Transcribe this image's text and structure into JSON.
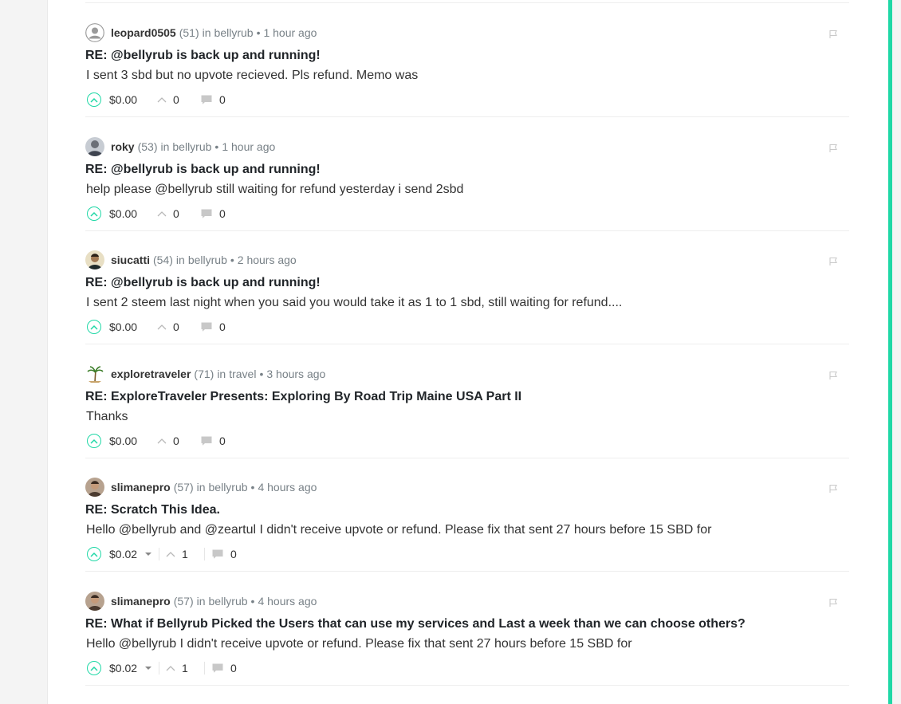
{
  "colors": {
    "accent": "#1fd8a6",
    "muted": "#788187"
  },
  "comments": [
    {
      "author": "leopard0505",
      "reputation": "(51)",
      "in_label": "in",
      "community": "bellyrub",
      "separator": "•",
      "time": "1 hour ago",
      "avatar": "default-user-avatar",
      "title": "RE: @bellyrub is back up and running!",
      "body": "I sent 3 sbd but no upvote recieved. Pls refund. Memo was",
      "payout": "$0.00",
      "votes": "0",
      "replies": "0",
      "has_dropdown": false
    },
    {
      "author": "roky",
      "reputation": "(53)",
      "in_label": "in",
      "community": "bellyrub",
      "separator": "•",
      "time": "1 hour ago",
      "avatar": "user-photo-avatar",
      "title": "RE: @bellyrub is back up and running!",
      "body": "help please @bellyrub still waiting for refund yesterday i send 2sbd",
      "payout": "$0.00",
      "votes": "0",
      "replies": "0",
      "has_dropdown": false
    },
    {
      "author": "siucatti",
      "reputation": "(54)",
      "in_label": "in",
      "community": "bellyrub",
      "separator": "•",
      "time": "2 hours ago",
      "avatar": "user-photo-avatar",
      "title": "RE: @bellyrub is back up and running!",
      "body": "I sent 2 steem last night when you said you would take it as 1 to 1 sbd, still waiting for refund....",
      "payout": "$0.00",
      "votes": "0",
      "replies": "0",
      "has_dropdown": false
    },
    {
      "author": "exploretraveler",
      "reputation": "(71)",
      "in_label": "in",
      "community": "travel",
      "separator": "•",
      "time": "3 hours ago",
      "avatar": "palm-tree-avatar",
      "title": "RE: ExploreTraveler Presents: Exploring By Road Trip Maine USA Part II",
      "body": "Thanks",
      "payout": "$0.00",
      "votes": "0",
      "replies": "0",
      "has_dropdown": false
    },
    {
      "author": "slimanepro",
      "reputation": "(57)",
      "in_label": "in",
      "community": "bellyrub",
      "separator": "•",
      "time": "4 hours ago",
      "avatar": "user-photo-avatar",
      "title": "RE: Scratch This Idea.",
      "body": "Hello @bellyrub and @zeartul I didn't receive upvote or refund. Please fix that sent 27 hours before 15 SBD for",
      "payout": "$0.02",
      "votes": "1",
      "replies": "0",
      "has_dropdown": true
    },
    {
      "author": "slimanepro",
      "reputation": "(57)",
      "in_label": "in",
      "community": "bellyrub",
      "separator": "•",
      "time": "4 hours ago",
      "avatar": "user-photo-avatar",
      "title": "RE: What if Bellyrub Picked the Users that can use my services and Last a week than we can choose others?",
      "body": "Hello @bellyrub I didn't receive upvote or refund. Please fix that sent 27 hours before 15 SBD for",
      "payout": "$0.02",
      "votes": "1",
      "replies": "0",
      "has_dropdown": true
    }
  ]
}
